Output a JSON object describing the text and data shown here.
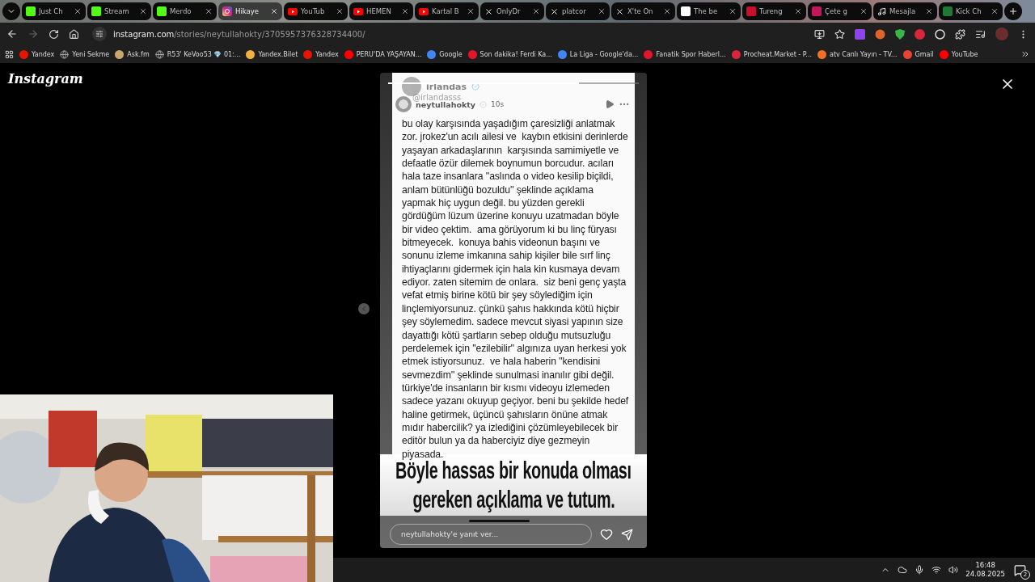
{
  "tabs": [
    {
      "title": "Just Ch",
      "kind": "kick",
      "selected": false
    },
    {
      "title": "Stream",
      "kind": "kick",
      "selected": false
    },
    {
      "title": "Merdo",
      "kind": "kick",
      "selected": false
    },
    {
      "title": "Hikaye",
      "kind": "instagram",
      "selected": true
    },
    {
      "title": "YouTub",
      "kind": "youtube",
      "selected": false
    },
    {
      "title": "HEMEN",
      "kind": "youtube",
      "selected": false
    },
    {
      "title": "Kartal B",
      "kind": "youtube",
      "selected": false
    },
    {
      "title": "OnlyDr",
      "kind": "x",
      "selected": false
    },
    {
      "title": "platcor",
      "kind": "x",
      "selected": false
    },
    {
      "title": "X'te On",
      "kind": "x",
      "selected": false
    },
    {
      "title": "The be",
      "kind": "dice",
      "selected": false
    },
    {
      "title": "Tureng",
      "kind": "tureng",
      "selected": false
    },
    {
      "title": "Çete g",
      "kind": "letterboxd",
      "selected": false
    },
    {
      "title": "Mesajla",
      "kind": "tiktok",
      "selected": false
    },
    {
      "title": "Kick Ch",
      "kind": "kickbox",
      "selected": false
    }
  ],
  "address_bar": {
    "host": "instagram.com",
    "path": "/stories/neytullahokty/3705957376328734400/"
  },
  "bookmarks": [
    {
      "label": "Yandex",
      "kind": "yandex"
    },
    {
      "label": "Yeni Sekme",
      "kind": "globe"
    },
    {
      "label": "Ask.fm",
      "kind": "avatar"
    },
    {
      "label": "R53' KeVoo53 💎 01:...",
      "kind": "globe"
    },
    {
      "label": "Yandex.Bilet",
      "kind": "smile"
    },
    {
      "label": "Yandex",
      "kind": "yandex"
    },
    {
      "label": "PERU'DA YAŞAYAN...",
      "kind": "youtube"
    },
    {
      "label": "Google",
      "kind": "google"
    },
    {
      "label": "Son dakika! Ferdi Ka...",
      "kind": "fanatik"
    },
    {
      "label": "La Liga - Google'da...",
      "kind": "google"
    },
    {
      "label": "Fanatik Spor Haberl...",
      "kind": "fanatik"
    },
    {
      "label": "Procheat.Market - P...",
      "kind": "procheat"
    },
    {
      "label": "atv Canlı Yayın - TV...",
      "kind": "atv"
    },
    {
      "label": "Gmail",
      "kind": "gmail"
    },
    {
      "label": "YouTube",
      "kind": "youtube"
    }
  ],
  "logo": "Instagram",
  "story": {
    "progress": {
      "level": 0.76
    },
    "embedded_post": {
      "author": "irlandas",
      "handle": "@irlandasss",
      "verified": true
    },
    "user": "neytullahokty",
    "verified": true,
    "age": "10s",
    "lines": [
      "bu olay karşısında yaşadığım çaresizliği anlatmak",
      "zor. jrokez'un acılı ailesi ve  kaybın etkisini derinlerde",
      "yaşayan arkadaşlarının  karşısında samimiyetle ve",
      "defaatle özür dilemek boynumun borcudur. acıları",
      "hala taze insanlara ''aslında o video kesilip biçildi,",
      "anlam bütünlüğü bozuldu'' şeklinde açıklama",
      "yapmak hiç uygun değil. bu yüzden gerekli",
      "gördüğüm lüzum üzerine konuyu uzatmadan böyle",
      "bir video çektim.  ama görüyorum ki bu linç füryası",
      "bitmeyecek.  konuya bahis videonun başını ve",
      "sonunu izleme imkanına sahip kişiler bile sırf linç",
      "ihtiyaçlarını gidermek için hala kin kusmaya devam",
      "ediyor. zaten sitemim de onlara.  siz beni genç yaşta",
      "vefat etmiş birine kötü bir şey söylediğim için",
      "linçlemiyorsunuz. çünkü şahıs hakkında kötü hiçbir",
      "şey söylemedim. sadece mevcut siyasi yapının size",
      "dayattığı kötü şartların sebep olduğu mutsuzluğu",
      "perdelemek için ''ezilebilir'' algınıza uyan herkesi yok",
      "etmek istiyorsunuz.  ve hala haberin ''kendisini",
      "sevmezdim'' şeklinde sunulmasi inanılır gibi değil.",
      "türkiye'de insanların bir kısmı videoyu izlemeden",
      "sadece yazanı okuyup geçiyor. beni bu şekilde hedef",
      "haline getirmek, üçüncü şahısların önüne atmak",
      "mıdır habercilik? ya izlediğini çözümleyebilecek bir",
      "editör bulun ya da haberciyiz diye gezmeyin",
      "piyasada."
    ],
    "headline": [
      "Böyle hassas bir konuda olması",
      "gereken açıklama ve tutum."
    ],
    "reply": {
      "placeholder": "neytullahokty'e yanıt ver..."
    }
  },
  "taskbar": {
    "time": "16:48",
    "date": "24.08.2025",
    "notifications": "2"
  }
}
